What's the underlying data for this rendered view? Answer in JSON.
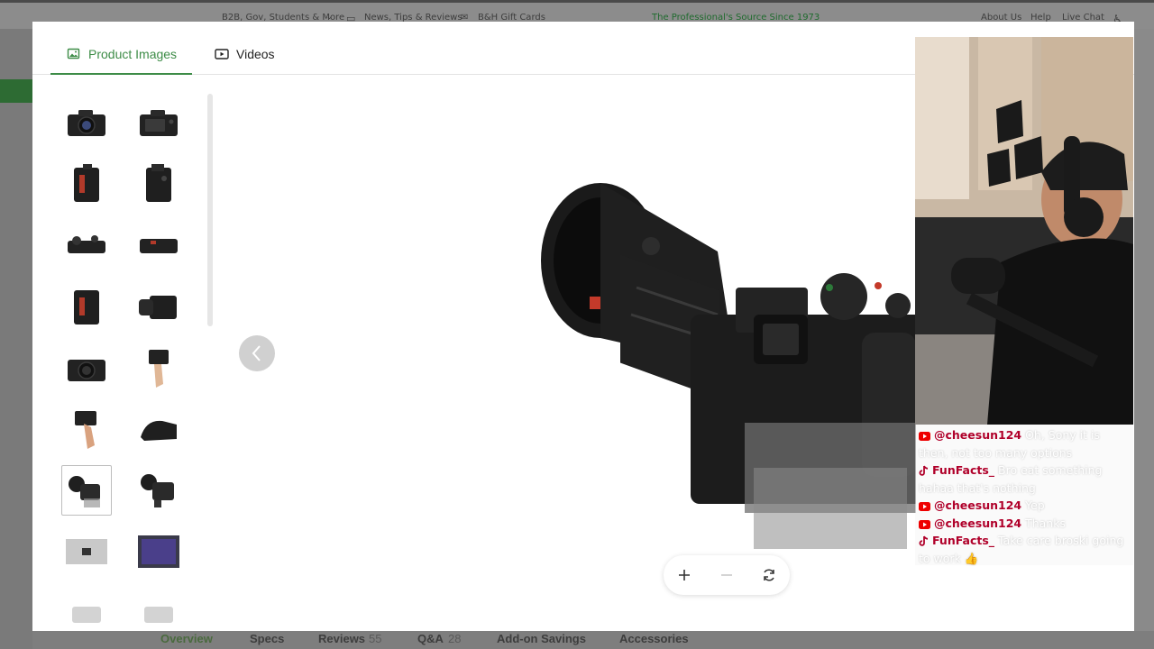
{
  "background": {
    "topbar": {
      "b2b": "B2B, Gov, Students & More",
      "news": "News, Tips & Reviews",
      "gift": "B&H Gift Cards",
      "tagline": "The Professional's Source Since 1973",
      "about": "About Us",
      "help": "Help",
      "chat": "Live Chat"
    },
    "tabs": {
      "overview": "Overview",
      "specs": "Specs",
      "reviews": "Reviews",
      "reviews_count": "55",
      "qa": "Q&A",
      "qa_count": "28",
      "addon": "Add-on Savings",
      "accessories": "Accessories"
    }
  },
  "modal": {
    "tabs": [
      {
        "label": "Product Images",
        "active": true,
        "icon": "image-icon"
      },
      {
        "label": "Videos",
        "active": false,
        "icon": "video-icon"
      }
    ],
    "thumbnails": [
      "camera-front",
      "camera-back",
      "camera-side-left",
      "camera-side-right",
      "camera-top",
      "camera-bottom",
      "camera-left-angle",
      "camera-lens-angle",
      "camera-front-2",
      "camera-in-hand",
      "camera-hand-grip",
      "camera-low-angle",
      "camera-flip-screen",
      "camera-flip-screen-2",
      "sensor-box",
      "sensor-chip",
      "camera-partial-1",
      "camera-partial-2"
    ],
    "selected_thumbnail": 12,
    "accent_color": "#3d8c47"
  },
  "stream_chat": [
    {
      "platform": "youtube",
      "user": "@cheesun124",
      "message": "Oh, Sony it is then, not too many options"
    },
    {
      "platform": "tiktok",
      "user": "FunFacts_",
      "message": "Bro eat something hahaa that's nothing"
    },
    {
      "platform": "youtube",
      "user": "@cheesun124",
      "message": "Yep"
    },
    {
      "platform": "youtube",
      "user": "@cheesun124",
      "message": "Thanks"
    },
    {
      "platform": "tiktok",
      "user": "FunFacts_",
      "message": "Take care broski going to work 👍"
    }
  ]
}
